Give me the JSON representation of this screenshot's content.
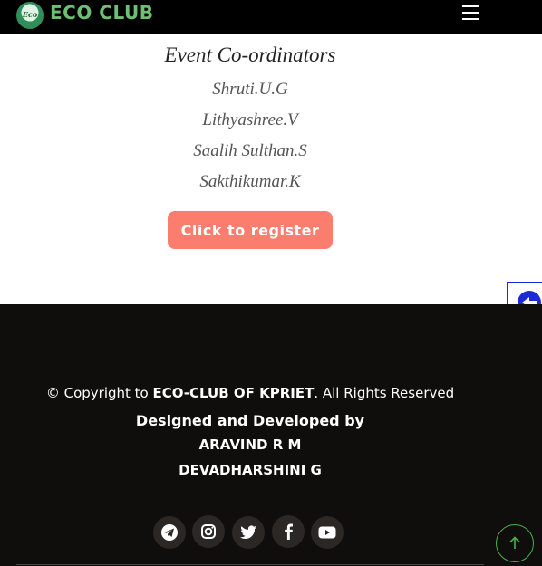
{
  "header": {
    "logo_text": "Eco",
    "brand": "ECO CLUB",
    "menu_icon": "hamburger-menu-icon"
  },
  "event": {
    "title": "Event Co-ordinators",
    "coordinators": [
      "Shruti.U.G",
      "Lithyashree.V",
      "Saalih Sulthan.S",
      "Sakthikumar.K"
    ],
    "register_label": "Click to register",
    "register_color": "#fa7d6d"
  },
  "side_tab": {
    "icon": "arrow-left-icon",
    "color": "#1a2bd6"
  },
  "footer": {
    "copyright_prefix": "© Copyright to ",
    "copyright_org": "ECO-CLUB OF KPRIET",
    "copyright_suffix": ". All Rights Reserved",
    "designed_by": "Designed and Developed by",
    "developers": [
      "ARAVIND R M",
      "DEVADHARSHINI G"
    ],
    "social_icons": [
      "telegram-icon",
      "instagram-icon",
      "twitter-icon",
      "facebook-icon",
      "youtube-icon"
    ],
    "background": "#100e0d"
  },
  "back_to_top": {
    "icon": "arrow-up-icon",
    "color": "#48b04a"
  }
}
